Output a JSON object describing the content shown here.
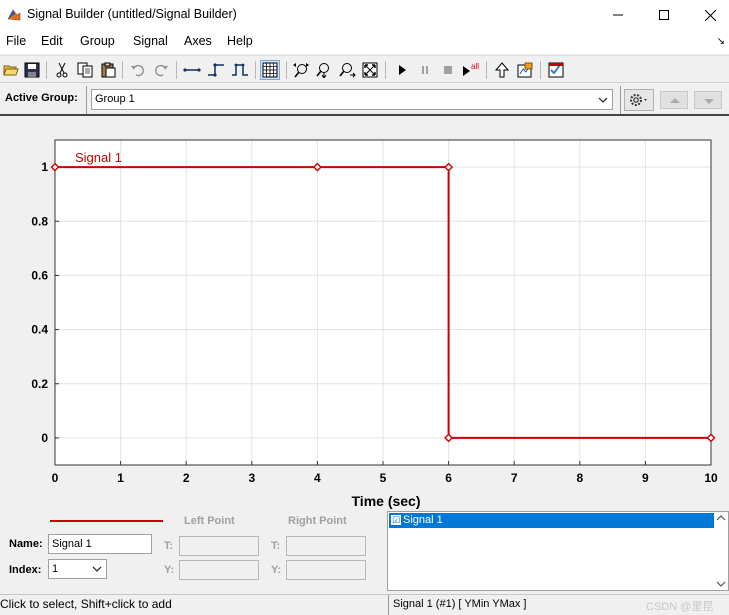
{
  "window": {
    "title": "Signal Builder (untitled/Signal Builder)",
    "minimize_glyph": "—",
    "maximize_glyph": "☐",
    "close_glyph": "✕"
  },
  "menu": {
    "items": [
      "File",
      "Edit",
      "Group",
      "Signal",
      "Axes",
      "Help"
    ],
    "arrow": "↘"
  },
  "toolbar": {
    "icons": [
      "open-folder-icon",
      "save-icon",
      "cut-icon",
      "copy-icon",
      "paste-icon",
      "undo-icon",
      "redo-icon",
      "insert-line-icon",
      "insert-step-up-icon",
      "insert-pulse-icon",
      "grid-icon",
      "zoom-xy-icon",
      "zoom-x-icon",
      "zoom-y-icon",
      "fit-icon",
      "play-icon",
      "pause-icon",
      "stop-icon",
      "run-all-icon",
      "up-arrow-icon",
      "import-icon",
      "checklist-icon"
    ],
    "run_all_text": "all"
  },
  "group_row": {
    "label": "Active Group:",
    "selected": "Group 1",
    "dropdown_arrow": "⌄"
  },
  "chart_data": {
    "type": "line",
    "xlabel": "Time (sec)",
    "ylabel": "",
    "xlim": [
      0,
      10
    ],
    "ylim": [
      -0.1,
      1.1
    ],
    "x_ticks": [
      "0",
      "1",
      "2",
      "3",
      "4",
      "5",
      "6",
      "7",
      "8",
      "9",
      "10"
    ],
    "y_ticks": [
      "0",
      "0.2",
      "0.4",
      "0.6",
      "0.8",
      "1"
    ],
    "grid": true,
    "series": [
      {
        "name": "Signal 1",
        "color": "#cc0000",
        "x": [
          0,
          4,
          6,
          6,
          10
        ],
        "y": [
          1,
          1,
          1,
          0,
          0
        ],
        "markers": [
          [
            0,
            1
          ],
          [
            4,
            1
          ],
          [
            6,
            1
          ],
          [
            6,
            0
          ],
          [
            10,
            0
          ]
        ]
      }
    ]
  },
  "point_panel": {
    "left_point": "Left Point",
    "right_point": "Right Point",
    "name_label": "Name:",
    "name_value": "Signal 1",
    "index_label": "Index:",
    "index_value": "1",
    "t_label": "T:",
    "y_label": "Y:"
  },
  "signal_list": {
    "items": [
      "Signal 1"
    ],
    "check": "☑"
  },
  "statusbar": {
    "hint": "Click to select, Shift+click to add",
    "info": "Signal 1 (#1)  [ YMin YMax ]",
    "watermark": "CSDN @里昆"
  }
}
